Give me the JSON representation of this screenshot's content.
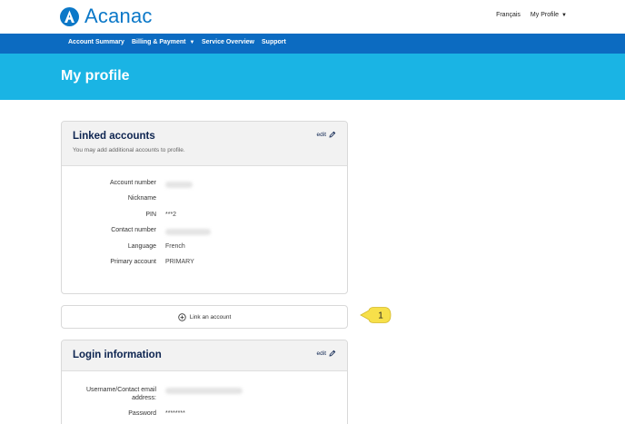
{
  "header": {
    "brand": "Acanac",
    "language_link": "Français",
    "profile_menu": "My Profile",
    "colors": {
      "brand": "#0b78c8",
      "nav": "#0c6bc1",
      "hero": "#1ab4e4"
    }
  },
  "nav": {
    "items": [
      {
        "label": "Account Summary"
      },
      {
        "label": "Billing & Payment"
      },
      {
        "label": "Service Overview"
      },
      {
        "label": "Support"
      }
    ]
  },
  "page": {
    "title": "My profile"
  },
  "linked_accounts": {
    "title": "Linked accounts",
    "subtitle": "You may add additional accounts to profile.",
    "edit_label": "edit",
    "rows": [
      {
        "label": "Account number",
        "value": ""
      },
      {
        "label": "Nickname",
        "value": ""
      },
      {
        "label": "PIN",
        "value": "***2"
      },
      {
        "label": "Contact number",
        "value": ""
      },
      {
        "label": "Language",
        "value": "French"
      },
      {
        "label": "Primary account",
        "value": "PRIMARY"
      }
    ]
  },
  "link_account": {
    "label": "Link an account"
  },
  "callout": {
    "number": "1"
  },
  "login_info": {
    "title": "Login information",
    "edit_label": "edit",
    "rows": [
      {
        "label": "Username/Contact email address:",
        "value": ""
      },
      {
        "label": "Password",
        "value": "********"
      }
    ]
  }
}
